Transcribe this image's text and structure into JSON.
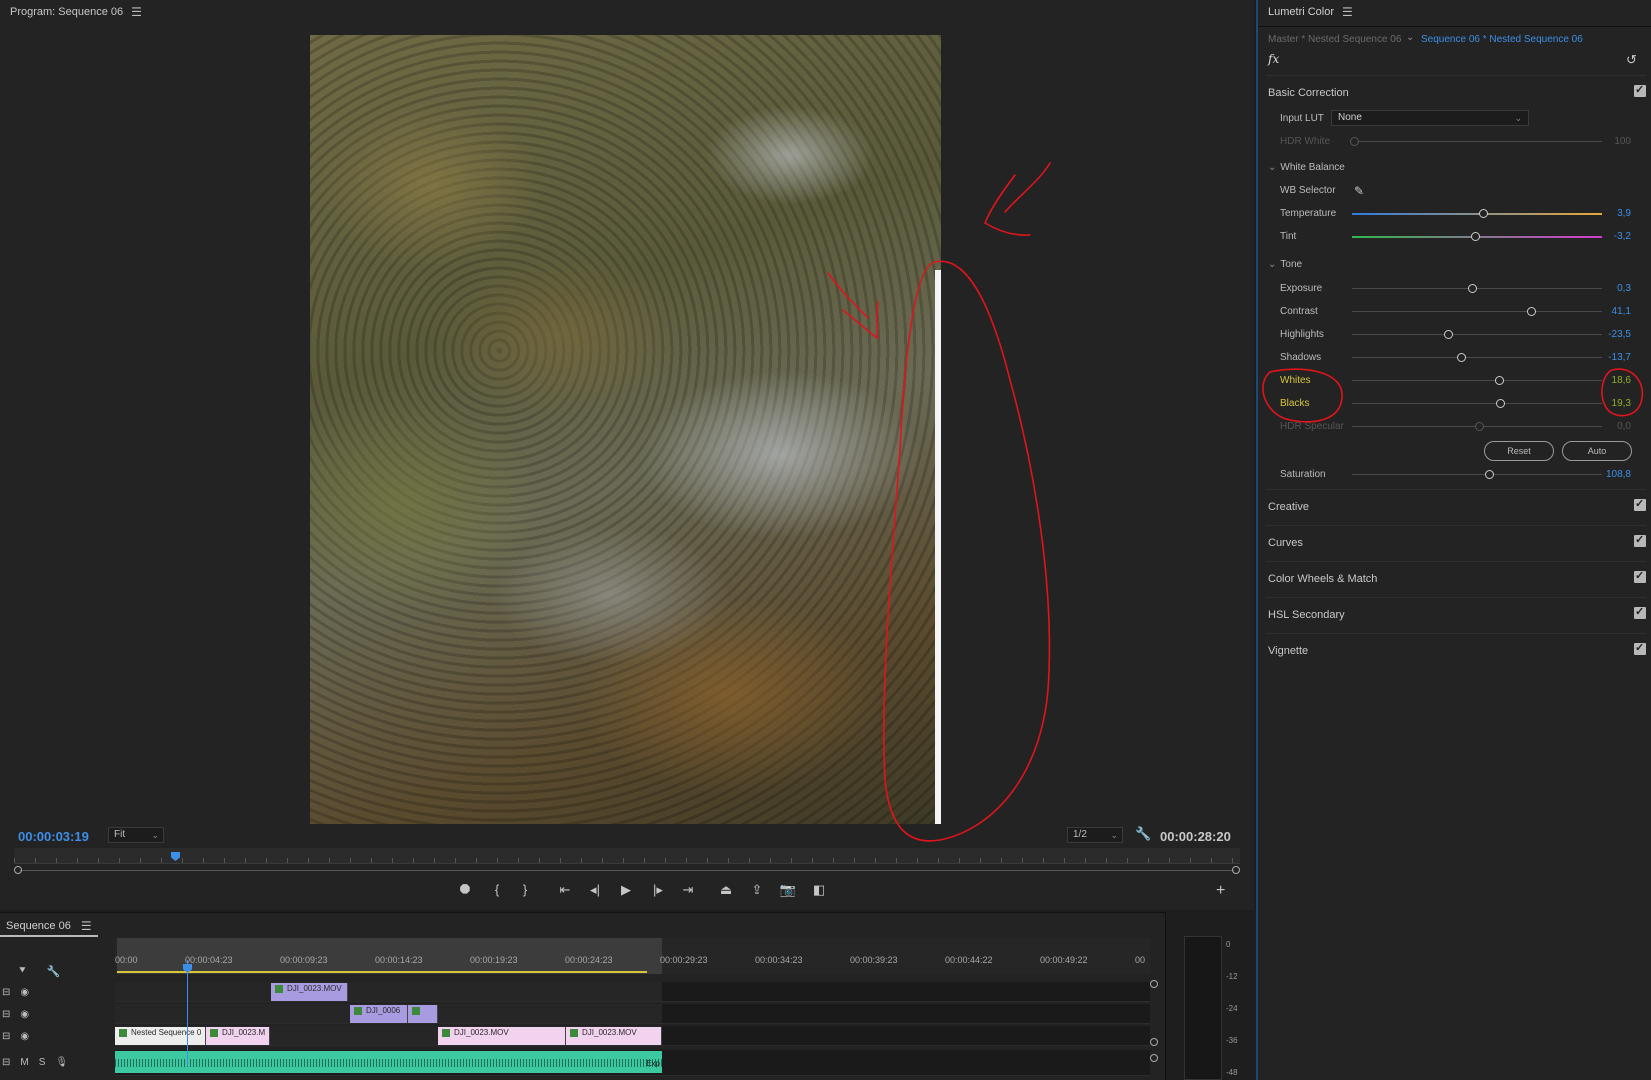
{
  "program": {
    "title": "Program: Sequence 06",
    "timecode_current": "00:00:03:19",
    "fit_value": "Fit",
    "resolution_value": "1/2",
    "timecode_duration": "00:00:28:20"
  },
  "timeline": {
    "tab_label": "Sequence 06",
    "ruler_labels": [
      "00:00",
      "00:00:04:23",
      "00:00:09:23",
      "00:00:14:23",
      "00:00:19:23",
      "00:00:24:23",
      "00:00:29:23",
      "00:00:34:23",
      "00:00:39:23",
      "00:00:44:22",
      "00:00:49:22",
      "00"
    ],
    "clips": {
      "v3_clip1": "DJI_0023.MOV",
      "v2_clip1": "DJI_0006",
      "v1_clip1": "Nested Sequence 0",
      "v1_clip2": "DJI_0023.M",
      "v1_clip3": "DJI_0023.MOV",
      "v1_clip4": "DJI_0023.MOV",
      "a1_tail": "Exp"
    },
    "audio_track_buttons": {
      "mute": "M",
      "solo": "S"
    },
    "meter_labels": [
      "0",
      "-12",
      "-24",
      "-36",
      "-48"
    ]
  },
  "lumetri": {
    "title": "Lumetri Color",
    "master_tab": "Master * Nested Sequence 06",
    "sequence_tab": "Sequence 06 * Nested Sequence 06",
    "fx_label": "fx",
    "basic_correction": {
      "title": "Basic Correction",
      "input_lut_label": "Input LUT",
      "input_lut_value": "None",
      "hdr_white_label": "HDR White",
      "hdr_white_value": "100",
      "white_balance_label": "White Balance",
      "wb_selector_label": "WB Selector",
      "temperature_label": "Temperature",
      "temperature_value": "3,9",
      "tint_label": "Tint",
      "tint_value": "-3,2",
      "tone_label": "Tone",
      "exposure_label": "Exposure",
      "exposure_value": "0,3",
      "contrast_label": "Contrast",
      "contrast_value": "41,1",
      "highlights_label": "Highlights",
      "highlights_value": "-23,5",
      "shadows_label": "Shadows",
      "shadows_value": "-13,7",
      "whites_label": "Whites",
      "whites_value": "18,6",
      "blacks_label": "Blacks",
      "blacks_value": "19,3",
      "hdr_specular_label": "HDR Specular",
      "hdr_specular_value": "0,0",
      "reset_label": "Reset",
      "auto_label": "Auto",
      "saturation_label": "Saturation",
      "saturation_value": "108,8"
    },
    "sections": [
      "Creative",
      "Curves",
      "Color Wheels & Match",
      "HSL Secondary",
      "Vignette"
    ]
  },
  "colors": {
    "accent": "#3d8ee6",
    "annotation": "#e0141c",
    "highlight_text": "#d8c63a"
  }
}
